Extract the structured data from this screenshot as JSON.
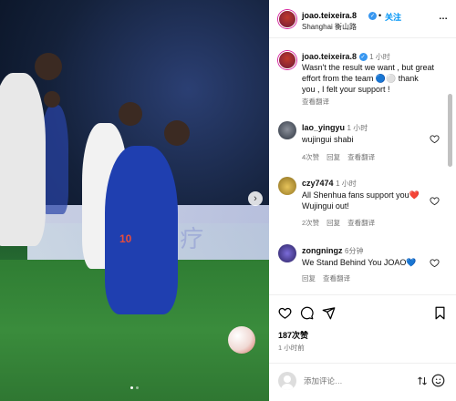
{
  "post": {
    "username": "joao.teixeira.8",
    "follow_label": "关注",
    "location": "Shanghai 衡山路",
    "more_label": "…"
  },
  "caption": {
    "username": "joao.teixeira.8",
    "time": "1 小时",
    "line1": "Wasn't the result we want , but great",
    "line2": "effort from the team 🔵⚪ thank",
    "line3": "you , I felt your support !",
    "translate": "查看翻译"
  },
  "comments": [
    {
      "username": "lao_yingyu",
      "time": "1 小时",
      "text": "wujingui shabi",
      "likes": "4次赞",
      "reply": "回复",
      "translate": "查看翻译"
    },
    {
      "username": "czy7474",
      "time": "1 小时",
      "line1": "All Shenhua fans support you❤️",
      "line2": "Wujingui out!",
      "likes": "2次赞",
      "reply": "回复",
      "translate": "查看翻译"
    },
    {
      "username": "zongningz",
      "time": "6分钟",
      "text": "We Stand Behind You JOAO💙",
      "reply": "回复",
      "translate": "查看翻译"
    }
  ],
  "engagement": {
    "likes": "187次赞",
    "time": "1 小时前"
  },
  "comment_box": {
    "placeholder": "添加评论…"
  },
  "photo": {
    "board_text": "医 疗",
    "jersey_number": "10"
  },
  "colors": {
    "link_blue": "#0095f6",
    "verified_blue": "#3897f0",
    "secondary_text": "#737373"
  }
}
